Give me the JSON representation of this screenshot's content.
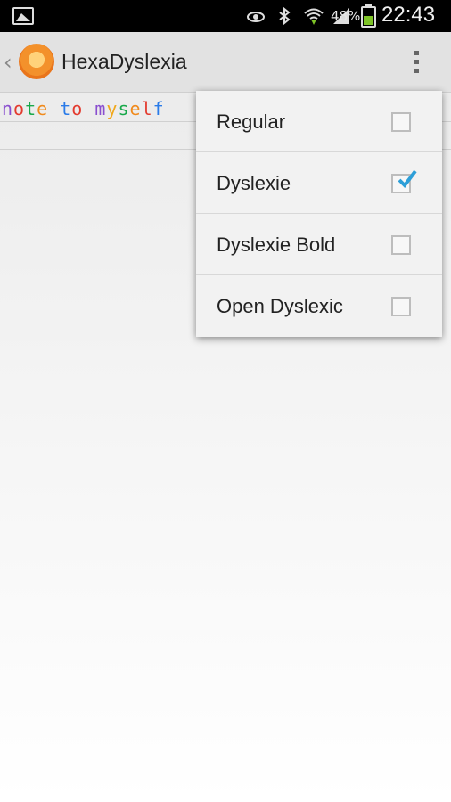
{
  "status_bar": {
    "battery_pct": "48%",
    "time": "22:43",
    "battery_level": 0.48
  },
  "action_bar": {
    "title": "HexaDyslexia"
  },
  "editor": {
    "text_segments": [
      {
        "text": "n",
        "color": "#8a4fcf"
      },
      {
        "text": "o",
        "color": "#e33b2f"
      },
      {
        "text": "t",
        "color": "#18a84a"
      },
      {
        "text": "e",
        "color": "#f08a1c"
      },
      {
        "text": " ",
        "color": "#000000"
      },
      {
        "text": "t",
        "color": "#2a7be8"
      },
      {
        "text": "o",
        "color": "#e33b2f"
      },
      {
        "text": " ",
        "color": "#000000"
      },
      {
        "text": "m",
        "color": "#8a4fcf"
      },
      {
        "text": "y",
        "color": "#f0a81c"
      },
      {
        "text": "s",
        "color": "#18a84a"
      },
      {
        "text": "e",
        "color": "#f08a1c"
      },
      {
        "text": "l",
        "color": "#e33b2f"
      },
      {
        "text": "f",
        "color": "#2a7be8"
      }
    ]
  },
  "menu": {
    "items": [
      {
        "label": "Regular",
        "checked": false
      },
      {
        "label": "Dyslexie",
        "checked": true
      },
      {
        "label": "Dyslexie Bold",
        "checked": false
      },
      {
        "label": "Open Dyslexic",
        "checked": false
      }
    ]
  },
  "colors": {
    "accent": "#2d9fd8"
  },
  "icons": [
    "gallery-icon",
    "eye-icon",
    "bluetooth-icon",
    "wifi-icon",
    "signal-icon",
    "battery-icon",
    "up-chevron-icon",
    "app-logo",
    "overflow-menu-icon",
    "checkmark-icon"
  ]
}
